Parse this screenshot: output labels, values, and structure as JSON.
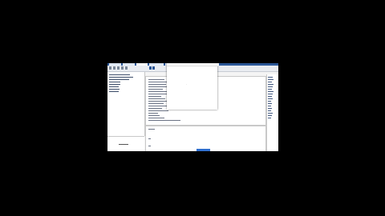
{
  "app": {
    "title": "",
    "tabs": [
      "",
      "",
      "",
      "",
      ""
    ]
  },
  "toolbar": {
    "buttons": [
      "open",
      "save",
      "run",
      "debug",
      "stop",
      "step"
    ]
  },
  "dialog": {
    "title": "",
    "marker": "·"
  },
  "left_panel": {
    "info_text": ""
  },
  "colors": {
    "background": "#000000",
    "titlebar": "#2b5797",
    "primary_button": "#2f6fd0"
  },
  "icons": [
    "folder-icon",
    "save-icon",
    "play-icon",
    "bug-icon",
    "stop-icon"
  ]
}
